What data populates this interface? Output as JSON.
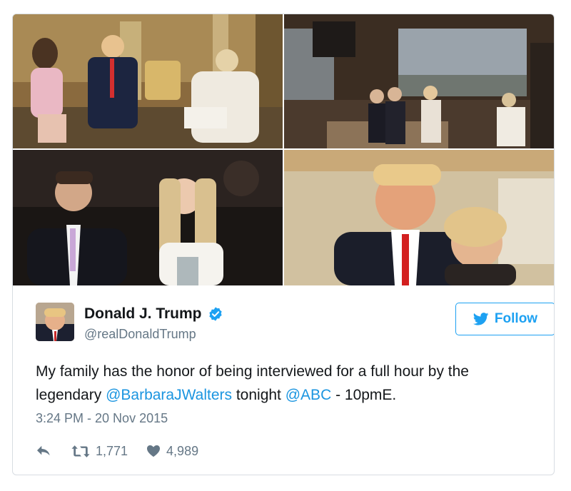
{
  "media": [
    {
      "alt": "Interview photo 1"
    },
    {
      "alt": "Interview photo 2"
    },
    {
      "alt": "Interview photo 3"
    },
    {
      "alt": "Interview photo 4"
    }
  ],
  "user": {
    "display_name": "Donald J. Trump",
    "handle": "@realDonaldTrump",
    "verified": true
  },
  "follow_label": "Follow",
  "tweet": {
    "text_part1": "My family has the honor of being interviewed for a full hour by the legendary ",
    "mention1": "@BarbaraJWalters",
    "text_part2": " tonight ",
    "mention2": "@ABC",
    "text_part3": " - 10pmE."
  },
  "timestamp": "3:24 PM - 20 Nov 2015",
  "stats": {
    "retweets": "1,771",
    "likes": "4,989"
  },
  "colors": {
    "accent": "#1da1f2",
    "link": "#1b95e0",
    "muted": "#657786"
  }
}
